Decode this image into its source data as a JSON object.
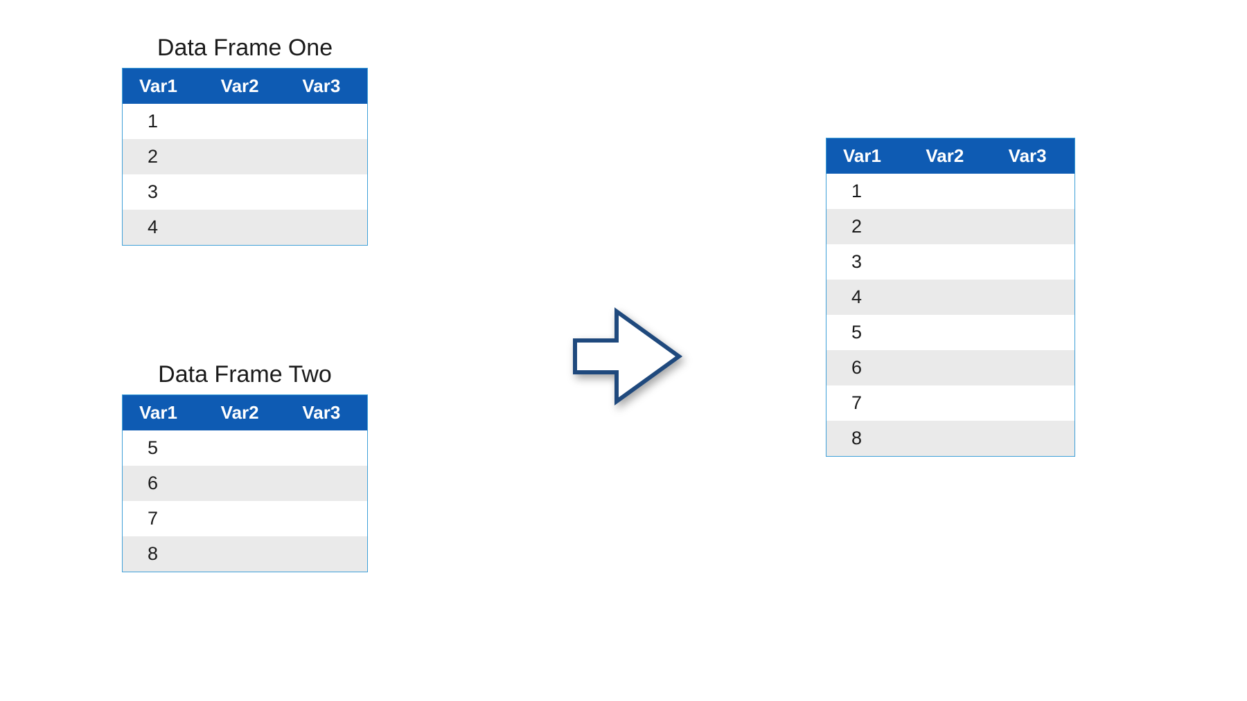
{
  "titles": {
    "df1": "Data Frame One",
    "df2": "Data Frame Two"
  },
  "headers": {
    "col1": "Var1",
    "col2": "Var2",
    "col3": "Var3"
  },
  "tables": {
    "df1": {
      "rows": [
        {
          "c1": "1",
          "c2": "",
          "c3": ""
        },
        {
          "c1": "2",
          "c2": "",
          "c3": ""
        },
        {
          "c1": "3",
          "c2": "",
          "c3": ""
        },
        {
          "c1": "4",
          "c2": "",
          "c3": ""
        }
      ]
    },
    "df2": {
      "rows": [
        {
          "c1": "5",
          "c2": "",
          "c3": ""
        },
        {
          "c1": "6",
          "c2": "",
          "c3": ""
        },
        {
          "c1": "7",
          "c2": "",
          "c3": ""
        },
        {
          "c1": "8",
          "c2": "",
          "c3": ""
        }
      ]
    },
    "result": {
      "rows": [
        {
          "c1": "1",
          "c2": "",
          "c3": ""
        },
        {
          "c1": "2",
          "c2": "",
          "c3": ""
        },
        {
          "c1": "3",
          "c2": "",
          "c3": ""
        },
        {
          "c1": "4",
          "c2": "",
          "c3": ""
        },
        {
          "c1": "5",
          "c2": "",
          "c3": ""
        },
        {
          "c1": "6",
          "c2": "",
          "c3": ""
        },
        {
          "c1": "7",
          "c2": "",
          "c3": ""
        },
        {
          "c1": "8",
          "c2": "",
          "c3": ""
        }
      ]
    }
  },
  "colors": {
    "header_bg": "#0e5bb3",
    "header_text": "#ffffff",
    "row_even": "#eaeaea",
    "row_odd": "#ffffff",
    "border": "#3d9fd8",
    "arrow_stroke": "#1f497d",
    "arrow_fill": "#ffffff"
  }
}
